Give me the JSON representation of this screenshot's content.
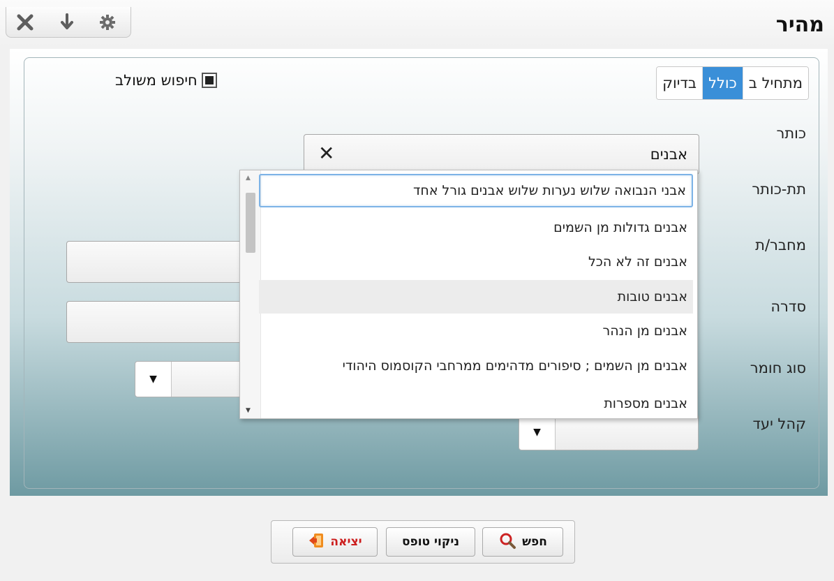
{
  "window": {
    "title": "מהיר"
  },
  "toolbar": {
    "icons": [
      "close-icon",
      "pin-down-icon",
      "gear-icon"
    ]
  },
  "search_mode": {
    "options": [
      "מתחיל ב",
      "כולל",
      "בדיוק"
    ],
    "selected": "כולל"
  },
  "combined_search": {
    "label": "חיפוש משולב",
    "checked": true
  },
  "fields": {
    "title_label": "כותר",
    "subtitle_label": "תת-כותר",
    "author_label": "מחבר/ת",
    "series_label": "סדרה",
    "material_label": "סוג חומר",
    "audience_label": "קהל יעד",
    "title_value": "אבנים",
    "clear_symbol": "✕",
    "dropdown_arrow": "▼"
  },
  "suggestions": {
    "items": [
      "אבני הנבואה שלוש נערות שלוש אבנים גורל אחד",
      "אבנים גדולות מן השמים",
      "אבנים זה לא הכל",
      "אבנים טובות",
      "אבנים מן הנהר",
      "אבנים מן השמים ; סיפורים מדהימים ממרחבי הקוסמוס היהודי",
      "אבנים מספרות"
    ],
    "focused_index": 0,
    "hovered_index": 3
  },
  "actions": {
    "search": "חפש",
    "clear_form": "ניקוי טופס",
    "exit": "יציאה"
  },
  "colors": {
    "accent": "#3a8fd8",
    "exit_text": "#cc1e1e",
    "search_icon": "#cc2222"
  }
}
